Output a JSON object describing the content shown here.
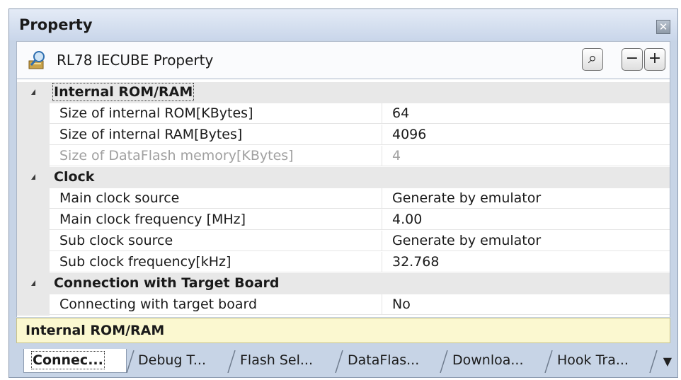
{
  "panel": {
    "title": "Property"
  },
  "toolbar": {
    "title": "RL78 IECUBE Property",
    "search_label": "⌕",
    "collapse_label": "−",
    "expand_label": "+"
  },
  "categories": [
    {
      "label": "Internal ROM/RAM",
      "items": [
        {
          "name": "Size of internal ROM[KBytes]",
          "value": "64",
          "disabled": false
        },
        {
          "name": "Size of internal RAM[Bytes]",
          "value": "4096",
          "disabled": false
        },
        {
          "name": "Size of DataFlash memory[KBytes]",
          "value": "4",
          "disabled": true
        }
      ]
    },
    {
      "label": "Clock",
      "items": [
        {
          "name": "Main clock source",
          "value": "Generate by emulator",
          "disabled": false
        },
        {
          "name": "Main clock frequency [MHz]",
          "value": "4.00",
          "disabled": false
        },
        {
          "name": "Sub clock source",
          "value": "Generate by emulator",
          "disabled": false
        },
        {
          "name": "Sub clock frequency[kHz]",
          "value": "32.768",
          "disabled": false
        }
      ]
    },
    {
      "label": "Connection with Target Board",
      "items": [
        {
          "name": "Connecting with target board",
          "value": "No",
          "disabled": false
        }
      ]
    }
  ],
  "description": "Internal ROM/RAM",
  "tabs": [
    {
      "label": "Connec...",
      "active": true
    },
    {
      "label": "Debug T...",
      "active": false
    },
    {
      "label": "Flash Sel...",
      "active": false
    },
    {
      "label": "DataFlas...",
      "active": false
    },
    {
      "label": "Downloa...",
      "active": false
    },
    {
      "label": "Hook Tra...",
      "active": false
    }
  ],
  "colors": {
    "panel_bg": "#c7d4e6",
    "category_bg": "#e8e8e8",
    "description_bg": "#fbf8d0",
    "disabled_text": "#a0a0a0"
  }
}
